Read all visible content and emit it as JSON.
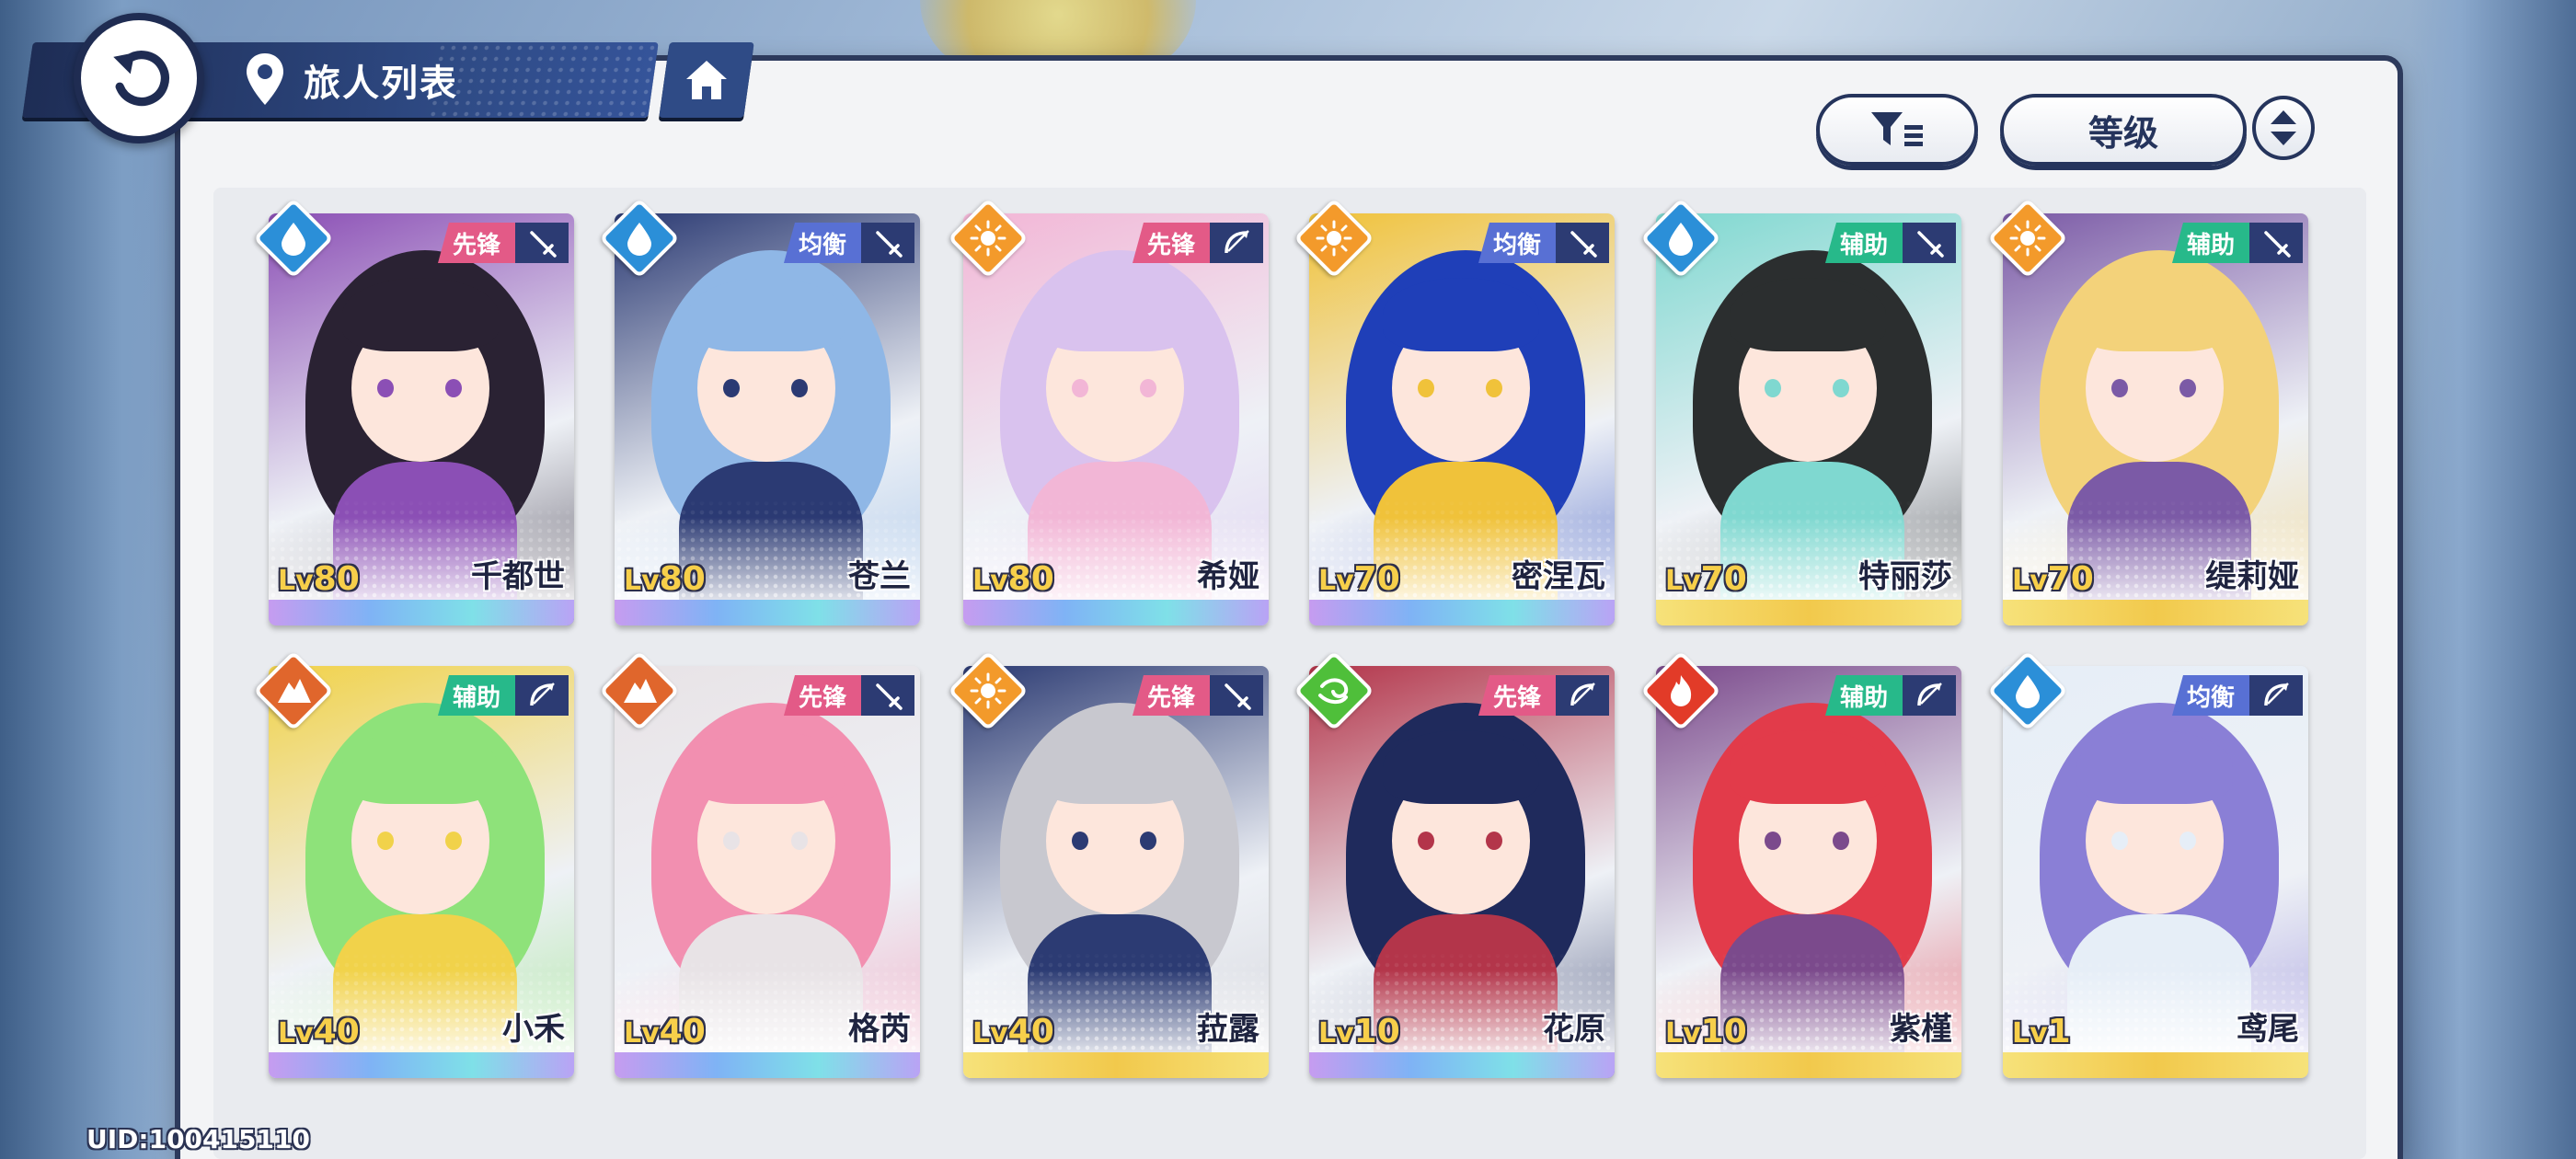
{
  "header": {
    "title": "旅人列表",
    "back_icon": "back-arrow-icon",
    "location_icon": "location-pin-icon",
    "home_icon": "home-icon"
  },
  "toolbar": {
    "filter_icon": "filter-icon",
    "sort_label": "等级",
    "order_icon": "sort-order-icon"
  },
  "level_prefix": "Lv",
  "footer": {
    "uid": "UID:100415110"
  },
  "colors": {
    "panel": "#f3f4f6",
    "navy": "#25345c",
    "role_vanguard": "#e35a87",
    "role_balance": "#5870d4",
    "role_support": "#27b98a",
    "water": "#2b8fd8",
    "light": "#f39a2b",
    "earth": "#e0662c",
    "fire": "#e23b28",
    "wind": "#4fbf3a"
  },
  "characters": [
    {
      "name": "千都世",
      "level": "80",
      "role": "先锋",
      "element": "water",
      "weapon": "sword",
      "hair": "#2a2233",
      "accent": "#8b4fb5",
      "frame": "rainbow"
    },
    {
      "name": "苍兰",
      "level": "80",
      "role": "均衡",
      "element": "water",
      "weapon": "sword",
      "hair": "#8fb7e6",
      "accent": "#2b3a73",
      "frame": "rainbow"
    },
    {
      "name": "希娅",
      "level": "80",
      "role": "先锋",
      "element": "light",
      "weapon": "bow",
      "hair": "#d9c2ee",
      "accent": "#f2b6d6",
      "frame": "rainbow"
    },
    {
      "name": "密涅瓦",
      "level": "70",
      "role": "均衡",
      "element": "light",
      "weapon": "sword",
      "hair": "#1f3fb8",
      "accent": "#f0c23a",
      "frame": "rainbow"
    },
    {
      "name": "特丽莎",
      "level": "70",
      "role": "辅助",
      "element": "water",
      "weapon": "sword",
      "hair": "#2b2e2f",
      "accent": "#7fd8d0",
      "frame": "gold"
    },
    {
      "name": "缇莉娅",
      "level": "70",
      "role": "辅助",
      "element": "light",
      "weapon": "sword",
      "hair": "#f3d27a",
      "accent": "#7b5aa6",
      "frame": "gold"
    },
    {
      "name": "小禾",
      "level": "40",
      "role": "辅助",
      "element": "earth",
      "weapon": "bow",
      "hair": "#8ee27a",
      "accent": "#f1d24a",
      "frame": "rainbow"
    },
    {
      "name": "格芮",
      "level": "40",
      "role": "先锋",
      "element": "earth",
      "weapon": "sword",
      "hair": "#f28fb0",
      "accent": "#e8e3e6",
      "frame": "rainbow"
    },
    {
      "name": "菈露",
      "level": "40",
      "role": "先锋",
      "element": "light",
      "weapon": "sword",
      "hair": "#c8c8cf",
      "accent": "#2c3b73",
      "frame": "gold"
    },
    {
      "name": "花原",
      "level": "10",
      "role": "先锋",
      "element": "wind",
      "weapon": "bow",
      "hair": "#1f2a5c",
      "accent": "#b3354a",
      "frame": "rainbow"
    },
    {
      "name": "紫槿",
      "level": "10",
      "role": "辅助",
      "element": "fire",
      "weapon": "bow",
      "hair": "#e23b4a",
      "accent": "#7b4a8c",
      "frame": "gold"
    },
    {
      "name": "鸢尾",
      "level": "1",
      "role": "均衡",
      "element": "water",
      "weapon": "bow",
      "hair": "#8a7fd6",
      "accent": "#e6eef7",
      "frame": "gold"
    }
  ]
}
